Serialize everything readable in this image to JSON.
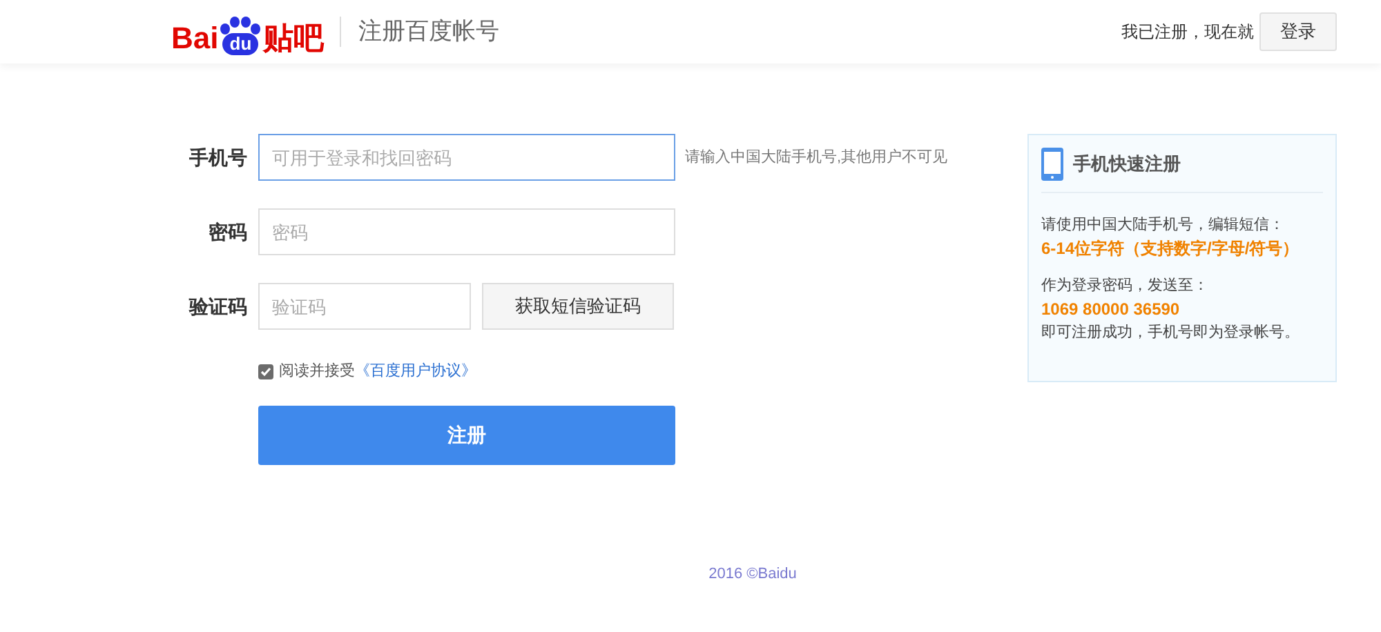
{
  "header": {
    "logo": {
      "left": "Bai",
      "badge": "du",
      "right": "贴吧"
    },
    "title": "注册百度帐号",
    "login_prompt": "我已注册，现在就",
    "login_button": "登录"
  },
  "form": {
    "fields": [
      {
        "kind": "input",
        "label": "手机号",
        "placeholder": "可用于登录和找回密码",
        "focused": true,
        "hint": "请输入中国大陆手机号,其他用户不可见"
      },
      {
        "kind": "input",
        "label": "密码",
        "placeholder": "密码",
        "focused": false
      },
      {
        "kind": "code",
        "label": "验证码",
        "placeholder": "验证码",
        "focused": false,
        "button": "获取短信验证码"
      }
    ],
    "agreement": {
      "checked": true,
      "text": "阅读并接受",
      "link": "《百度用户协议》"
    },
    "submit": "注册"
  },
  "side_panel": {
    "title": "手机快速注册",
    "line_1": "请使用中国大陆手机号，编辑短信：",
    "highlight_1": "6-14位字符（支持数字/字母/符号）",
    "line_2": "作为登录密码，发送至：",
    "highlight_2": "1069 80000 36590",
    "line_3": "即可注册成功，手机号即为登录帐号。"
  },
  "footer": "2016 ©Baidu"
}
